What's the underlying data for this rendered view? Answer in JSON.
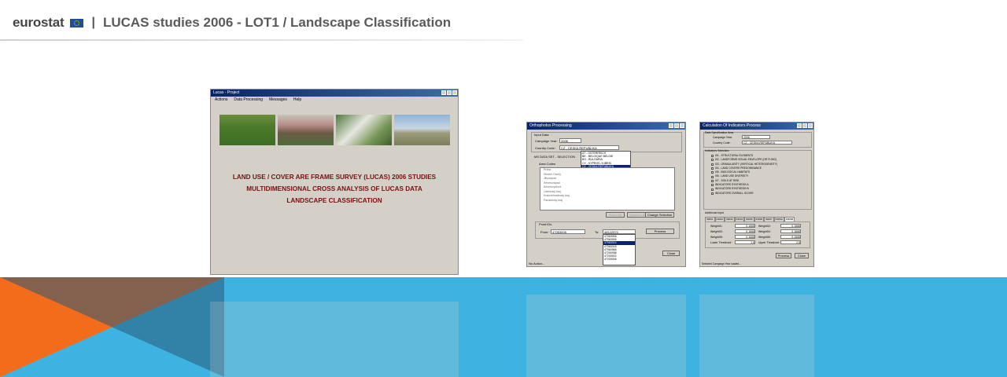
{
  "header": {
    "brand": "eurostat",
    "separator": "|",
    "title": "LUCAS studies 2006 - LOT1 / Landscape Classification"
  },
  "colors": {
    "band_blue": "#3eb2e0",
    "band_orange": "#f36c1c",
    "titlebar": "#0a246a",
    "project_text": "#7a1010"
  },
  "project_window": {
    "title": "Lucas - Project",
    "menu": [
      "Actions",
      "Data Processing",
      "Messages",
      "Help"
    ],
    "lines": [
      "LAND USE / COVER ARE FRAME SURVEY (LUCAS) 2006 STUDIES",
      "MULTIDIMENSIONAL CROSS ANALYSIS OF LUCAS DATA",
      "LANDSCAPE CLASSIFICATION"
    ]
  },
  "ortho_window": {
    "title": "Orthophotos Processing",
    "input_data": "Input Data",
    "campaign_label": "Campaign Year:",
    "campaign_value": "2006",
    "country_label": "Country Code:",
    "country_value": "CZ - CESKA REPUBLIKA",
    "tab": "MS DATA SET - SELECTION",
    "area_codes": "Area Codes",
    "country_list": [
      "AT - OSTERREICH",
      "BE - BELGIQUE BELGIE",
      "BG - BULGARIA",
      "CY - KYPROS / KIBRIS",
      "CZ - CESKA REPUBLIKA",
      "DE - DEUTSCHLAND",
      "DK - DANMARK",
      "EE - EESTI"
    ],
    "country_selected": 4,
    "tree_items": [
      "Praha",
      "Stredni Cechy",
      "Jihozapad",
      "Severozapad",
      "Severovychod",
      "Liberecky kraj",
      "Kralovehradecky kraj",
      "Pardubicky kraj"
    ],
    "buttons": {
      "select_all": "Select All",
      "unselect_all": "Unselect All",
      "change_selection": "Change Selection",
      "process": "Process",
      "close": "Close"
    },
    "point_ids": "Point IDs",
    "from_label": "From:",
    "from_value": "47063006",
    "to_label": "To:",
    "to_value": "48122970",
    "to_list": [
      "47063006",
      "47063006",
      "47063014",
      "47063018",
      "47063966",
      "47200998",
      "47203002",
      "47203006"
    ],
    "to_selected": 2,
    "status": "No Action..."
  },
  "indicators_window": {
    "title": "Calculation Of Indicators Process",
    "data_spec": "Data Specification Area",
    "campaign_label": "Campaign Year:",
    "campaign_value": "2006",
    "country_label": "Country Code:",
    "country_value": "CZ - CESKA REPUBLIKA",
    "indicators_label": "Indicators Selection",
    "indicators": [
      "I01 - STRUCTURAL ELEMENTS",
      "I02 - LANDFORMS VISUAL ENVELOPE (OR FLIND)",
      "I03 - GRANULARITY (VERTICAL HETEROGENEITY)",
      "I04 - LAND COVERS PREDOMINANCE",
      "I05 - BIOLOGICAL HABITATS",
      "I06 - LAND USE DIVERSITY",
      "I07 - SOILS AT RISK",
      "INDICATORS SYNTHESIS A",
      "INDICATORS SYNTHESIS B",
      "INDICATORS OVERALL SCORE"
    ],
    "additional_input": "Additional Input",
    "tabs": [
      "IND01",
      "IND02",
      "IND03",
      "IND04",
      "IND05",
      "IND06",
      "IND07",
      "INDSA",
      "INDSB"
    ],
    "weights": [
      {
        "label": "Weight01:",
        "value": "0.1666"
      },
      {
        "label": "Weight02:",
        "value": "0.1666"
      },
      {
        "label": "Weight03:",
        "value": "0.1666"
      },
      {
        "label": "Weight04:",
        "value": "0.1666"
      },
      {
        "label": "Weight05:",
        "value": "0.1666"
      },
      {
        "label": "Weight06:",
        "value": "0.1666"
      }
    ],
    "lower_label": "Lower Threshold:",
    "lower_value": "1.5",
    "upper_label": "Upper Threshold:",
    "upper_value": "2.5",
    "process": "Process",
    "close": "Close",
    "status": "Selected Campaign Year loaded..."
  }
}
